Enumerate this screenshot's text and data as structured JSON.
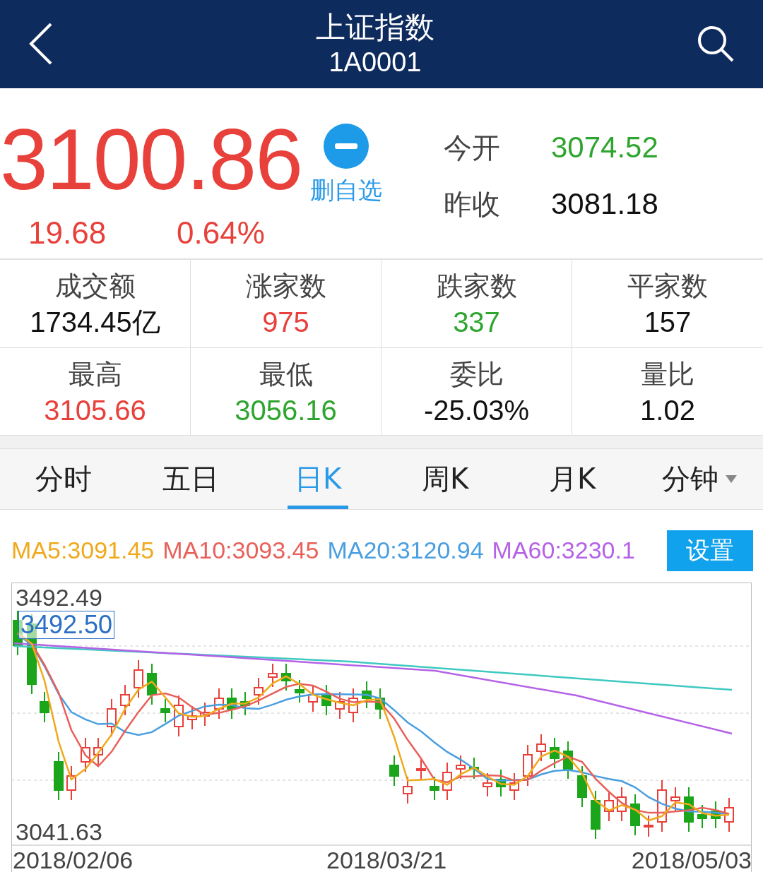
{
  "header": {
    "title": "上证指数",
    "code": "1A0001"
  },
  "quote": {
    "price": "3100.86",
    "change": "19.68",
    "change_pct": "0.64%",
    "color": "#e8403a",
    "watch_action": "删自选",
    "fields": [
      {
        "label": "今开",
        "value": "3074.52",
        "color": "#2ea52e"
      },
      {
        "label": "昨收",
        "value": "3081.18",
        "color": "#111111"
      }
    ]
  },
  "stats": [
    {
      "label": "成交额",
      "value": "1734.45亿",
      "color": "#111111"
    },
    {
      "label": "涨家数",
      "value": "975",
      "color": "#e8403a"
    },
    {
      "label": "跌家数",
      "value": "337",
      "color": "#2ea52e"
    },
    {
      "label": "平家数",
      "value": "157",
      "color": "#111111"
    },
    {
      "label": "最高",
      "value": "3105.66",
      "color": "#e8403a"
    },
    {
      "label": "最低",
      "value": "3056.16",
      "color": "#2ea52e"
    },
    {
      "label": "委比",
      "value": "-25.03%",
      "color": "#111111"
    },
    {
      "label": "量比",
      "value": "1.02",
      "color": "#111111"
    }
  ],
  "tabs": [
    {
      "label": "分时",
      "selected": false,
      "has_menu": false
    },
    {
      "label": "五日",
      "selected": false,
      "has_menu": false
    },
    {
      "label": "日K",
      "selected": true,
      "has_menu": false
    },
    {
      "label": "周K",
      "selected": false,
      "has_menu": false
    },
    {
      "label": "月K",
      "selected": false,
      "has_menu": false
    },
    {
      "label": "分钟",
      "selected": false,
      "has_menu": true
    }
  ],
  "legend": [
    {
      "label": "MA5:3091.45",
      "color": "#f0a91c"
    },
    {
      "label": "MA10:3093.45",
      "color": "#e8605a"
    },
    {
      "label": "MA20:3120.94",
      "color": "#4a9fe0"
    },
    {
      "label": "MA60:3230.1",
      "color": "#b462e6"
    }
  ],
  "settings_button": "设置",
  "chart": {
    "high_label": "3492.49",
    "crosshair_label": "3492.50",
    "low_label": "3041.63",
    "dates": [
      "2018/02/06",
      "2018/03/21",
      "2018/05/03"
    ]
  }
}
